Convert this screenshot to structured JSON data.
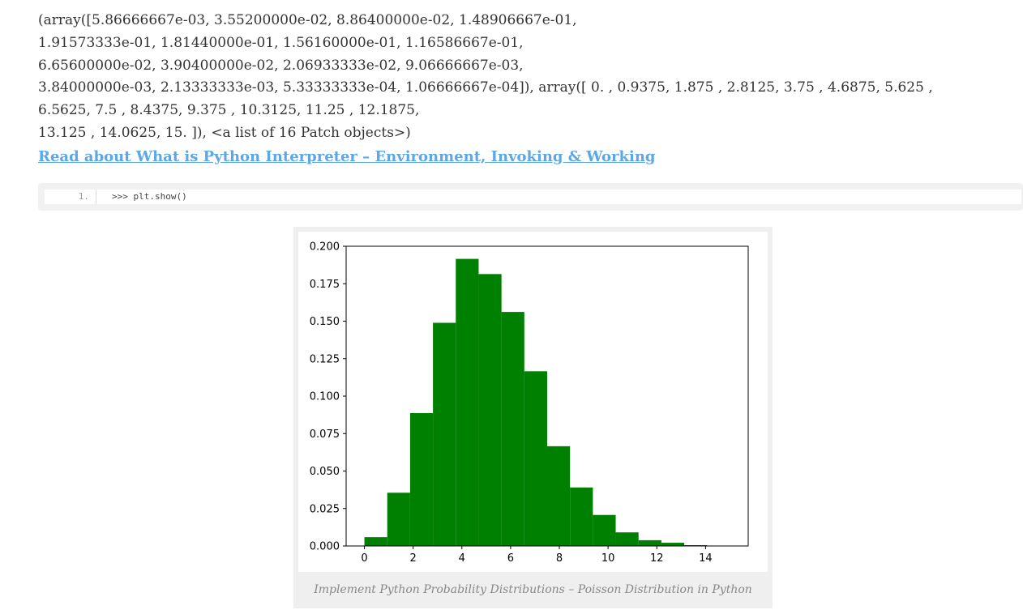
{
  "output": {
    "lines": [
      "(array([5.86666667e-03, 3.55200000e-02, 8.86400000e-02, 1.48906667e-01,",
      "1.91573333e-01, 1.81440000e-01, 1.56160000e-01, 1.16586667e-01,",
      "6.65600000e-02, 3.90400000e-02, 2.06933333e-02, 9.06666667e-03,",
      "3.84000000e-03, 2.13333333e-03, 5.33333333e-04, 1.06666667e-04]), array([ 0. , 0.9375, 1.875 , 2.8125, 3.75 , 4.6875, 5.625 ,",
      "6.5625, 7.5 , 8.4375, 9.375 , 10.3125, 11.25 , 12.1875,",
      "13.125 , 14.0625, 15. ]), <a list of 16 Patch objects>)"
    ]
  },
  "link": {
    "text": "Read about What is Python Interpreter – Environment, Invoking & Working"
  },
  "code": {
    "line_number": "1.",
    "text": ">>> plt.show()"
  },
  "figure": {
    "caption": "Implement Python Probability Distributions – Poisson Distribution in Python"
  },
  "colors": {
    "bar": "#008000",
    "link": "#5ea7e6"
  },
  "chart_data": {
    "type": "bar",
    "bin_edges": [
      0,
      0.9375,
      1.875,
      2.8125,
      3.75,
      4.6875,
      5.625,
      6.5625,
      7.5,
      8.4375,
      9.375,
      10.3125,
      11.25,
      12.1875,
      13.125,
      14.0625,
      15
    ],
    "values": [
      0.00586666667,
      0.03552,
      0.08864,
      0.148906667,
      0.191573333,
      0.18144,
      0.15616,
      0.116586667,
      0.06656,
      0.03904,
      0.0206933333,
      0.00906666667,
      0.00384,
      0.00213333333,
      0.000533333333,
      0.000106666667
    ],
    "xlim": [
      -0.75,
      15.75
    ],
    "ylim": [
      0,
      0.2
    ],
    "x_ticks": [
      0,
      2,
      4,
      6,
      8,
      10,
      12,
      14
    ],
    "x_tick_labels": [
      "0",
      "2",
      "4",
      "6",
      "8",
      "10",
      "12",
      "14"
    ],
    "y_ticks": [
      0,
      0.025,
      0.05,
      0.075,
      0.1,
      0.125,
      0.15,
      0.175,
      0.2
    ],
    "y_tick_labels": [
      "0.000",
      "0.025",
      "0.050",
      "0.075",
      "0.100",
      "0.125",
      "0.150",
      "0.175",
      "0.200"
    ],
    "title": "",
    "xlabel": "",
    "ylabel": "",
    "color": "#008000",
    "grid": false
  }
}
